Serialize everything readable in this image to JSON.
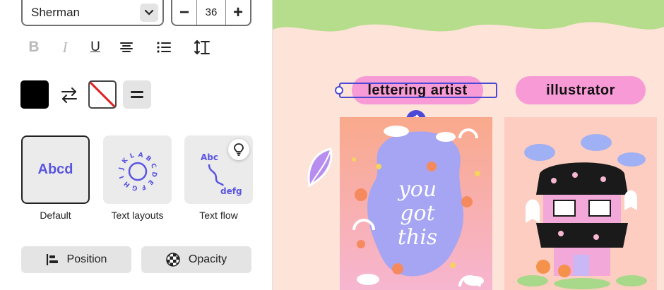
{
  "font": {
    "family": "Sherman"
  },
  "size": {
    "value": "36",
    "decrease": "−",
    "increase": "+"
  },
  "format": {
    "bold": "B",
    "italic": "I",
    "underline": "U"
  },
  "colors": {
    "fill": "#000000",
    "accent": "#5a55e0",
    "selection": "#4b49d6",
    "pill": "#f79ad6",
    "canvas_bg": "#fde3d8",
    "wave": "#b6dd8c"
  },
  "layouts": [
    {
      "label": "Default",
      "preview": "Abcd",
      "selected": true
    },
    {
      "label": "Text layouts",
      "preview": "ABCDEFGHIJKL"
    },
    {
      "label": "Text flow",
      "preview_top": "Abc",
      "preview_bottom": "defg"
    }
  ],
  "buttons": {
    "position": "Position",
    "opacity": "Opacity"
  },
  "canvas": {
    "pill_left": "lettering artist",
    "pill_right": "illustrator",
    "poster_left_text": [
      "you",
      "got",
      "this"
    ]
  }
}
